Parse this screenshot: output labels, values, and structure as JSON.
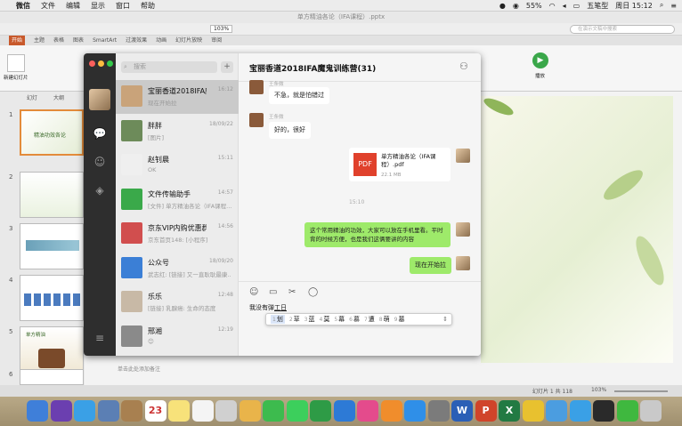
{
  "menubar": {
    "apple": "",
    "items": [
      "微信",
      "文件",
      "编辑",
      "显示",
      "窗口",
      "帮助"
    ],
    "battery": "55%",
    "input_method": "五笔型",
    "clock": "周日 15:12"
  },
  "ppt": {
    "title": "单方精油各论（IFA课程）.pptx",
    "zoom": "103%",
    "search_placeholder": "在演示文稿中搜索",
    "tabs": [
      "开始",
      "主题",
      "表格",
      "图表",
      "SmartArt",
      "过渡效果",
      "动画",
      "幻灯片放映",
      "审阅"
    ],
    "thumbs_header": [
      "幻灯",
      "大纲"
    ],
    "slide_numbers": [
      "1",
      "2",
      "3",
      "4",
      "5",
      "6"
    ],
    "thumb1_text": "精油功效各论",
    "thumb5_text": "单方精油",
    "buttons": {
      "new_slide": "新建幻灯片",
      "play": "播放"
    },
    "notes_placeholder": "单击此处添加备注",
    "status_left": "普通视图",
    "status_slide": "幻灯片 1 共 118",
    "status_zoom": "103%"
  },
  "wechat": {
    "search_placeholder": "搜索",
    "plus": "+",
    "conversations": [
      {
        "name": "宝丽香道2018IFA魔...",
        "time": "16:12",
        "preview": "现在开始拉",
        "color": "#c9a37a"
      },
      {
        "name": "胖胖",
        "time": "18/09/22",
        "preview": "[图片]",
        "color": "#6d8b5a"
      },
      {
        "name": "赵钊晨",
        "time": "15:11",
        "preview": "OK",
        "color": "#efefef"
      },
      {
        "name": "文件传输助手",
        "time": "14:57",
        "preview": "[文件] 单方精油各论（IFA课程...",
        "color": "#3aa94a"
      },
      {
        "name": "京东VIP内购优惠群...",
        "time": "14:56",
        "preview": "京东首页148: [小程序]",
        "color": "#d14e4e"
      },
      {
        "name": "公众号",
        "time": "18/09/20",
        "preview": "武志红: [链接] 又一直耿耿最康...",
        "color": "#3b7fd6"
      },
      {
        "name": "乐乐",
        "time": "12:48",
        "preview": "[链接] 乳腺癌: 生命的态度",
        "color": "#c8b9a6"
      },
      {
        "name": "邢湘",
        "time": "12:19",
        "preview": "😊",
        "color": "#8a8a8a"
      }
    ],
    "chat": {
      "title": "宝丽香道2018IFA魔鬼训练营(31)",
      "messages": [
        {
          "sender": "王条微",
          "text": "不急，就是怕错过",
          "side": "left"
        },
        {
          "sender": "王条微",
          "text": "好的，很好",
          "side": "left"
        },
        {
          "side": "right",
          "file_name": "单方精油各论（IFA课程）.pdf",
          "file_size": "22.1 MB",
          "file_badge": "PDF"
        },
        {
          "divider": "15:10"
        },
        {
          "side": "right",
          "text": "这个常用精油的功效，大家可以放在手机里看。平时背的时候方便，也是我们这俩要讲的内容"
        },
        {
          "side": "right",
          "text": "现在开始拉"
        }
      ],
      "input_text": "我没有弹",
      "input_composing": "工日",
      "ime_candidates": [
        {
          "n": "1",
          "c": "划",
          "selected": true
        },
        {
          "n": "2",
          "c": "草"
        },
        {
          "n": "3",
          "c": "蓝"
        },
        {
          "n": "4",
          "c": "莫"
        },
        {
          "n": "5",
          "c": "幕"
        },
        {
          "n": "6",
          "c": "慕"
        },
        {
          "n": "7",
          "c": "遭"
        },
        {
          "n": "8",
          "c": "萌"
        },
        {
          "n": "9",
          "c": "墓"
        }
      ],
      "ime_arrow": "⇕"
    }
  },
  "dock": {
    "apps": [
      {
        "icon": "finder-icon",
        "color": "#3f7fd9",
        "glyph": ""
      },
      {
        "icon": "siri-icon",
        "color": "#6b3fb0",
        "glyph": ""
      },
      {
        "icon": "safari-icon",
        "color": "#3aa0e6",
        "glyph": ""
      },
      {
        "icon": "photos-preview-icon",
        "color": "#5b7fb4",
        "glyph": ""
      },
      {
        "icon": "contacts-icon",
        "color": "#a88050",
        "glyph": ""
      },
      {
        "icon": "calendar-icon",
        "color": "#ffffff",
        "glyph": "23"
      },
      {
        "icon": "notes-icon",
        "color": "#f7e27a",
        "glyph": ""
      },
      {
        "icon": "reminders-icon",
        "color": "#f4f4f4",
        "glyph": ""
      },
      {
        "icon": "photo-booth-icon",
        "color": "#d0d0d0",
        "glyph": ""
      },
      {
        "icon": "photos-icon",
        "color": "#e9b44a",
        "glyph": ""
      },
      {
        "icon": "facetime-icon",
        "color": "#3dbb4e",
        "glyph": ""
      },
      {
        "icon": "messages-icon",
        "color": "#3ccf5c",
        "glyph": ""
      },
      {
        "icon": "numbers-icon",
        "color": "#2e9b46",
        "glyph": ""
      },
      {
        "icon": "keynote-icon",
        "color": "#2d7ad6",
        "glyph": ""
      },
      {
        "icon": "itunes-icon",
        "color": "#e44b8c",
        "glyph": ""
      },
      {
        "icon": "ibooks-icon",
        "color": "#f08d2c",
        "glyph": ""
      },
      {
        "icon": "app-store-icon",
        "color": "#2f8fe8",
        "glyph": ""
      },
      {
        "icon": "system-preferences-icon",
        "color": "#7b7b7b",
        "glyph": ""
      },
      {
        "icon": "word-icon",
        "color": "#2b5fb6",
        "glyph": "W"
      },
      {
        "icon": "powerpoint-icon",
        "color": "#d0442a",
        "glyph": "P"
      },
      {
        "icon": "excel-icon",
        "color": "#227a43",
        "glyph": "X"
      },
      {
        "icon": "keka-icon",
        "color": "#e8c12f",
        "glyph": ""
      },
      {
        "icon": "game-center-icon",
        "color": "#4b9de0",
        "glyph": ""
      },
      {
        "icon": "qq-icon",
        "color": "#3aa0e6",
        "glyph": ""
      },
      {
        "icon": "obs-icon",
        "color": "#2a2a2a",
        "glyph": ""
      },
      {
        "icon": "wechat-icon",
        "color": "#3fb83f",
        "glyph": ""
      },
      {
        "icon": "trash-icon",
        "color": "#c9c9c9",
        "glyph": ""
      }
    ]
  }
}
